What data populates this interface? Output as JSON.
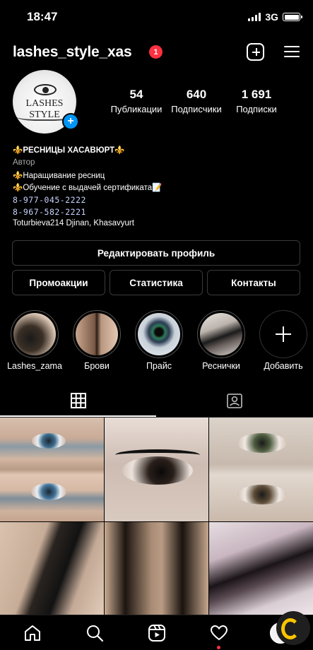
{
  "status_bar": {
    "time": "18:47",
    "network": "3G"
  },
  "header": {
    "username": "lashes_style_xas",
    "notification_count": "1"
  },
  "avatar": {
    "logo_text": "LASHES STYLE"
  },
  "stats": [
    {
      "value": "54",
      "label": "Публикации"
    },
    {
      "value": "640",
      "label": "Подписчики"
    },
    {
      "value": "1 691",
      "label": "Подписки"
    }
  ],
  "bio": {
    "name": "⚜️РЕСНИЦЫ ХАСАВЮРТ⚜️",
    "category": "Автор",
    "line1": "⚜️Наращивание ресниц",
    "line2": "⚜️Обучение с выдачей сертификата📝",
    "phone1": "8-977-045-2222",
    "phone2": "8-967-582-2221",
    "address": "Toturbieva214 Djinan, Khasavyurt"
  },
  "buttons": {
    "edit_profile": "Редактировать профиль",
    "promotions": "Промоакции",
    "statistics": "Статистика",
    "contacts": "Контакты"
  },
  "highlights": [
    {
      "label": "Lashes_zama"
    },
    {
      "label": "Брови"
    },
    {
      "label": "Прайс"
    },
    {
      "label": "Реснички"
    },
    {
      "label": "Добавить"
    }
  ],
  "colors": {
    "accent": "#0095f6",
    "badge": "#ff3040",
    "background": "#000000"
  }
}
